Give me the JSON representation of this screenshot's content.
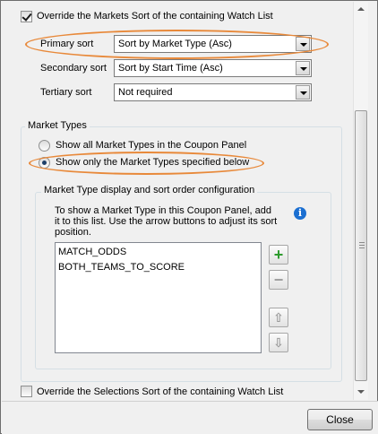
{
  "markets_sort": {
    "override_label": "Override the Markets Sort of the containing Watch List",
    "override_checked": true,
    "primary": {
      "label": "Primary sort",
      "value": "Sort by Market Type (Asc)"
    },
    "secondary": {
      "label": "Secondary sort",
      "value": "Sort by Start Time (Asc)"
    },
    "tertiary": {
      "label": "Tertiary sort",
      "value": "Not required"
    }
  },
  "market_types": {
    "group_title": "Market Types",
    "option_all": "Show all Market Types in the Coupon Panel",
    "option_specified": "Show only the Market Types specified below",
    "selected_option": "specified",
    "config": {
      "group_title": "Market Type display and sort order configuration",
      "help_text": "To show a Market Type in this Coupon Panel, add it to this list.  Use the arrow buttons to adjust its sort position.",
      "items": [
        "MATCH_ODDS",
        "BOTH_TEAMS_TO_SCORE"
      ],
      "add_icon": "plus-icon",
      "remove_icon": "minus-icon",
      "up_icon": "arrow-up-icon",
      "down_icon": "arrow-down-icon",
      "info_icon": "info-icon"
    }
  },
  "selections_sort": {
    "override_label": "Override the Selections Sort of the containing Watch List",
    "override_checked": false
  },
  "footer": {
    "close_label": "Close"
  },
  "colors": {
    "highlight_oval": "#e8893a",
    "info_blue": "#1b6fd1",
    "add_green": "#2e9b2e"
  }
}
